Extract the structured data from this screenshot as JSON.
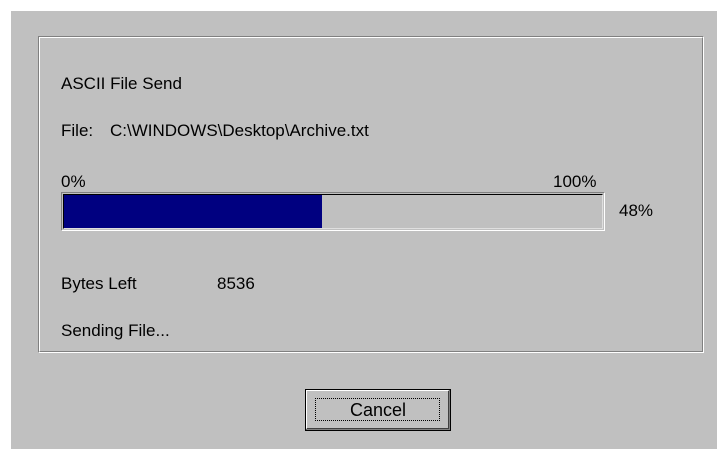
{
  "dialog": {
    "title": "ASCII File Send",
    "file_label": "File:",
    "file_path": "C:\\WINDOWS\\Desktop\\Archive.txt",
    "progress": {
      "min_label": "0%",
      "max_label": "100%",
      "percent_label": "48%",
      "fraction": 0.48,
      "fill_color": "#000080"
    },
    "bytes_left_label": "Bytes Left",
    "bytes_left_value": "8536",
    "status_text": "Sending File...",
    "cancel_label": "Cancel"
  }
}
